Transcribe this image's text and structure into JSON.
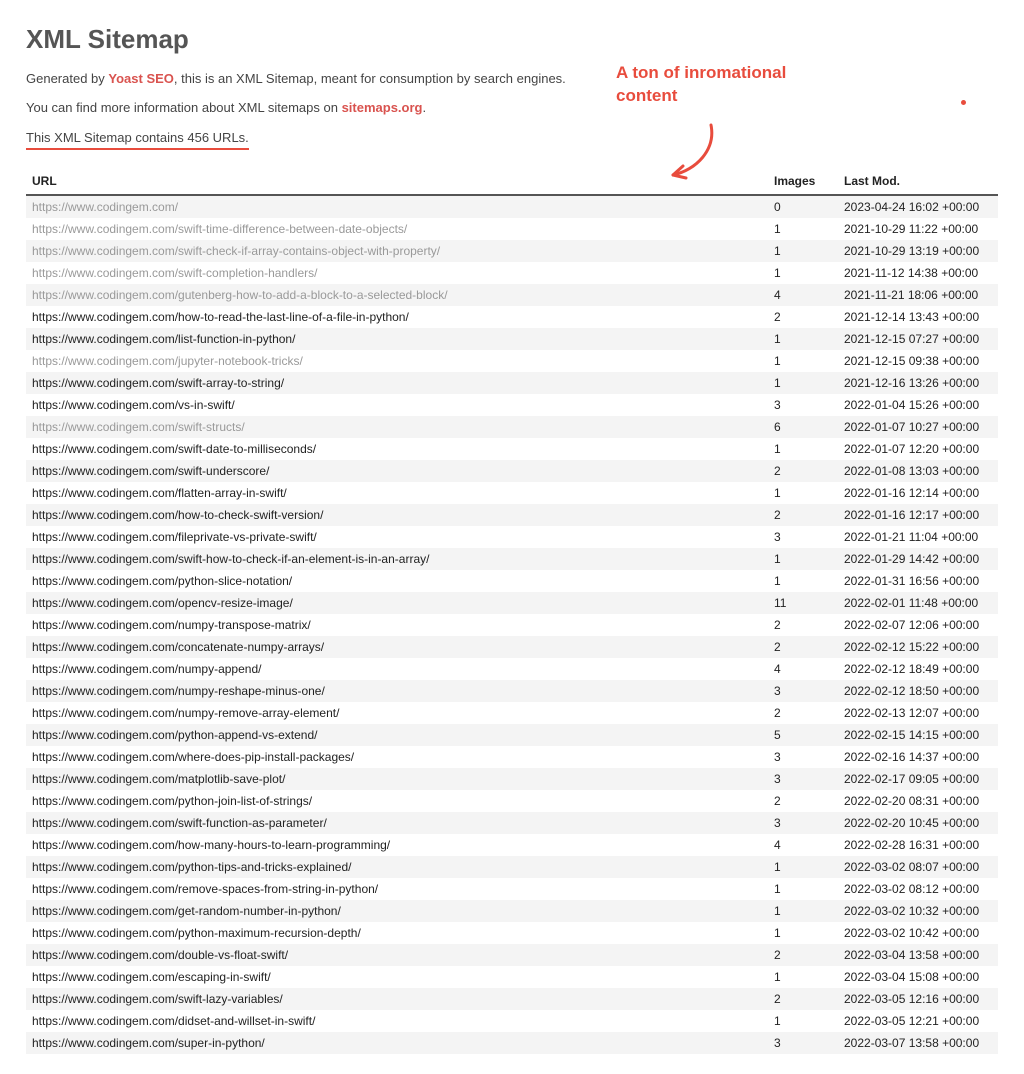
{
  "header": {
    "title": "XML Sitemap",
    "intro_prefix": "Generated by ",
    "intro_link": "Yoast SEO",
    "intro_suffix": ", this is an XML Sitemap, meant for consumption by search engines.",
    "more_prefix": "You can find more information about XML sitemaps on ",
    "more_link": "sitemaps.org",
    "more_suffix": ".",
    "count_line": "This XML Sitemap contains 456 URLs."
  },
  "annotation": {
    "line1": "A ton of inromational",
    "line2": "content"
  },
  "columns": {
    "url": "URL",
    "images": "Images",
    "lastmod": "Last Mod."
  },
  "rows": [
    {
      "url": "https://www.codingem.com/",
      "images": "0",
      "lastmod": "2023-04-24 16:02 +00:00",
      "muted": true
    },
    {
      "url": "https://www.codingem.com/swift-time-difference-between-date-objects/",
      "images": "1",
      "lastmod": "2021-10-29 11:22 +00:00",
      "muted": true
    },
    {
      "url": "https://www.codingem.com/swift-check-if-array-contains-object-with-property/",
      "images": "1",
      "lastmod": "2021-10-29 13:19 +00:00",
      "muted": true
    },
    {
      "url": "https://www.codingem.com/swift-completion-handlers/",
      "images": "1",
      "lastmod": "2021-11-12 14:38 +00:00",
      "muted": true
    },
    {
      "url": "https://www.codingem.com/gutenberg-how-to-add-a-block-to-a-selected-block/",
      "images": "4",
      "lastmod": "2021-11-21 18:06 +00:00",
      "muted": true
    },
    {
      "url": "https://www.codingem.com/how-to-read-the-last-line-of-a-file-in-python/",
      "images": "2",
      "lastmod": "2021-12-14 13:43 +00:00",
      "muted": false
    },
    {
      "url": "https://www.codingem.com/list-function-in-python/",
      "images": "1",
      "lastmod": "2021-12-15 07:27 +00:00",
      "muted": false
    },
    {
      "url": "https://www.codingem.com/jupyter-notebook-tricks/",
      "images": "1",
      "lastmod": "2021-12-15 09:38 +00:00",
      "muted": true
    },
    {
      "url": "https://www.codingem.com/swift-array-to-string/",
      "images": "1",
      "lastmod": "2021-12-16 13:26 +00:00",
      "muted": false
    },
    {
      "url": "https://www.codingem.com/vs-in-swift/",
      "images": "3",
      "lastmod": "2022-01-04 15:26 +00:00",
      "muted": false
    },
    {
      "url": "https://www.codingem.com/swift-structs/",
      "images": "6",
      "lastmod": "2022-01-07 10:27 +00:00",
      "muted": true
    },
    {
      "url": "https://www.codingem.com/swift-date-to-milliseconds/",
      "images": "1",
      "lastmod": "2022-01-07 12:20 +00:00",
      "muted": false
    },
    {
      "url": "https://www.codingem.com/swift-underscore/",
      "images": "2",
      "lastmod": "2022-01-08 13:03 +00:00",
      "muted": false
    },
    {
      "url": "https://www.codingem.com/flatten-array-in-swift/",
      "images": "1",
      "lastmod": "2022-01-16 12:14 +00:00",
      "muted": false
    },
    {
      "url": "https://www.codingem.com/how-to-check-swift-version/",
      "images": "2",
      "lastmod": "2022-01-16 12:17 +00:00",
      "muted": false
    },
    {
      "url": "https://www.codingem.com/fileprivate-vs-private-swift/",
      "images": "3",
      "lastmod": "2022-01-21 11:04 +00:00",
      "muted": false
    },
    {
      "url": "https://www.codingem.com/swift-how-to-check-if-an-element-is-in-an-array/",
      "images": "1",
      "lastmod": "2022-01-29 14:42 +00:00",
      "muted": false
    },
    {
      "url": "https://www.codingem.com/python-slice-notation/",
      "images": "1",
      "lastmod": "2022-01-31 16:56 +00:00",
      "muted": false
    },
    {
      "url": "https://www.codingem.com/opencv-resize-image/",
      "images": "11",
      "lastmod": "2022-02-01 11:48 +00:00",
      "muted": false
    },
    {
      "url": "https://www.codingem.com/numpy-transpose-matrix/",
      "images": "2",
      "lastmod": "2022-02-07 12:06 +00:00",
      "muted": false
    },
    {
      "url": "https://www.codingem.com/concatenate-numpy-arrays/",
      "images": "2",
      "lastmod": "2022-02-12 15:22 +00:00",
      "muted": false
    },
    {
      "url": "https://www.codingem.com/numpy-append/",
      "images": "4",
      "lastmod": "2022-02-12 18:49 +00:00",
      "muted": false
    },
    {
      "url": "https://www.codingem.com/numpy-reshape-minus-one/",
      "images": "3",
      "lastmod": "2022-02-12 18:50 +00:00",
      "muted": false
    },
    {
      "url": "https://www.codingem.com/numpy-remove-array-element/",
      "images": "2",
      "lastmod": "2022-02-13 12:07 +00:00",
      "muted": false
    },
    {
      "url": "https://www.codingem.com/python-append-vs-extend/",
      "images": "5",
      "lastmod": "2022-02-15 14:15 +00:00",
      "muted": false
    },
    {
      "url": "https://www.codingem.com/where-does-pip-install-packages/",
      "images": "3",
      "lastmod": "2022-02-16 14:37 +00:00",
      "muted": false
    },
    {
      "url": "https://www.codingem.com/matplotlib-save-plot/",
      "images": "3",
      "lastmod": "2022-02-17 09:05 +00:00",
      "muted": false
    },
    {
      "url": "https://www.codingem.com/python-join-list-of-strings/",
      "images": "2",
      "lastmod": "2022-02-20 08:31 +00:00",
      "muted": false
    },
    {
      "url": "https://www.codingem.com/swift-function-as-parameter/",
      "images": "3",
      "lastmod": "2022-02-20 10:45 +00:00",
      "muted": false
    },
    {
      "url": "https://www.codingem.com/how-many-hours-to-learn-programming/",
      "images": "4",
      "lastmod": "2022-02-28 16:31 +00:00",
      "muted": false
    },
    {
      "url": "https://www.codingem.com/python-tips-and-tricks-explained/",
      "images": "1",
      "lastmod": "2022-03-02 08:07 +00:00",
      "muted": false
    },
    {
      "url": "https://www.codingem.com/remove-spaces-from-string-in-python/",
      "images": "1",
      "lastmod": "2022-03-02 08:12 +00:00",
      "muted": false
    },
    {
      "url": "https://www.codingem.com/get-random-number-in-python/",
      "images": "1",
      "lastmod": "2022-03-02 10:32 +00:00",
      "muted": false
    },
    {
      "url": "https://www.codingem.com/python-maximum-recursion-depth/",
      "images": "1",
      "lastmod": "2022-03-02 10:42 +00:00",
      "muted": false
    },
    {
      "url": "https://www.codingem.com/double-vs-float-swift/",
      "images": "2",
      "lastmod": "2022-03-04 13:58 +00:00",
      "muted": false
    },
    {
      "url": "https://www.codingem.com/escaping-in-swift/",
      "images": "1",
      "lastmod": "2022-03-04 15:08 +00:00",
      "muted": false
    },
    {
      "url": "https://www.codingem.com/swift-lazy-variables/",
      "images": "2",
      "lastmod": "2022-03-05 12:16 +00:00",
      "muted": false
    },
    {
      "url": "https://www.codingem.com/didset-and-willset-in-swift/",
      "images": "1",
      "lastmod": "2022-03-05 12:21 +00:00",
      "muted": false
    },
    {
      "url": "https://www.codingem.com/super-in-python/",
      "images": "3",
      "lastmod": "2022-03-07 13:58 +00:00",
      "muted": false
    }
  ]
}
